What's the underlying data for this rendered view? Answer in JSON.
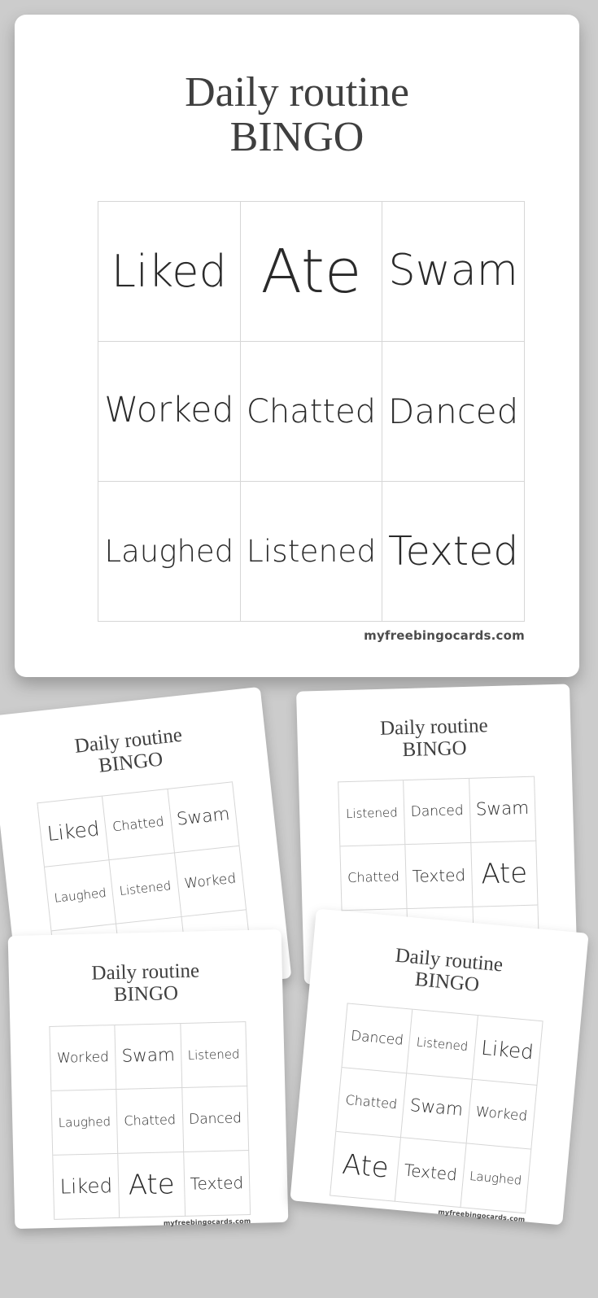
{
  "theme": {
    "background_color": "#cccccc",
    "card_color": "#ffffff",
    "grid_line_color": "#d6d6d6",
    "title_color": "#3f3f3f",
    "cell_text_color": "#2a2a2a",
    "watermark_color": "#4c4c4c"
  },
  "title": {
    "line1": "Daily routine",
    "line2": "BINGO",
    "full": "Daily routine\nBINGO"
  },
  "watermark": "myfreebingocards.com",
  "cards": [
    {
      "id": "main",
      "title": "Daily routine\nBINGO",
      "watermark": "myfreebingocards.com",
      "rows": [
        [
          "Liked",
          "Ate",
          "Swam"
        ],
        [
          "Worked",
          "Chatted",
          "Danced"
        ],
        [
          "Laughed",
          "Listened",
          "Texted"
        ]
      ],
      "cells": [
        "Liked",
        "Ate",
        "Swam",
        "Worked",
        "Chatted",
        "Danced",
        "Laughed",
        "Listened",
        "Texted"
      ]
    },
    {
      "id": "thumb-1",
      "title": "Daily routine\nBINGO",
      "watermark": "myfreebingocards.com",
      "rows": [
        [
          "Liked",
          "Chatted",
          "Swam"
        ],
        [
          "Laughed",
          "Listened",
          "Worked"
        ],
        [
          "",
          "",
          ""
        ]
      ],
      "cells": [
        "Liked",
        "Chatted",
        "Swam",
        "Laughed",
        "Listened",
        "Worked",
        "",
        "",
        ""
      ]
    },
    {
      "id": "thumb-2",
      "title": "Daily routine\nBINGO",
      "watermark": "myfreebingocards.com",
      "rows": [
        [
          "Listened",
          "Danced",
          "Swam"
        ],
        [
          "Chatted",
          "Texted",
          "Ate"
        ],
        [
          "",
          "",
          ""
        ]
      ],
      "cells": [
        "Listened",
        "Danced",
        "Swam",
        "Chatted",
        "Texted",
        "Ate",
        "",
        "",
        ""
      ]
    },
    {
      "id": "thumb-3",
      "title": "Daily routine\nBINGO",
      "watermark": "myfreebingocards.com",
      "rows": [
        [
          "Worked",
          "Swam",
          "Listened"
        ],
        [
          "Laughed",
          "Chatted",
          "Danced"
        ],
        [
          "Liked",
          "Ate",
          "Texted"
        ]
      ],
      "cells": [
        "Worked",
        "Swam",
        "Listened",
        "Laughed",
        "Chatted",
        "Danced",
        "Liked",
        "Ate",
        "Texted"
      ]
    },
    {
      "id": "thumb-4",
      "title": "Daily routine\nBINGO",
      "watermark": "myfreebingocards.com",
      "rows": [
        [
          "Danced",
          "Listened",
          "Liked"
        ],
        [
          "Chatted",
          "Swam",
          "Worked"
        ],
        [
          "Ate",
          "Texted",
          "Laughed"
        ]
      ],
      "cells": [
        "Danced",
        "Listened",
        "Liked",
        "Chatted",
        "Swam",
        "Worked",
        "Ate",
        "Texted",
        "Laughed"
      ]
    }
  ],
  "word_pool": [
    "Liked",
    "Ate",
    "Swam",
    "Worked",
    "Chatted",
    "Danced",
    "Laughed",
    "Listened",
    "Texted"
  ]
}
